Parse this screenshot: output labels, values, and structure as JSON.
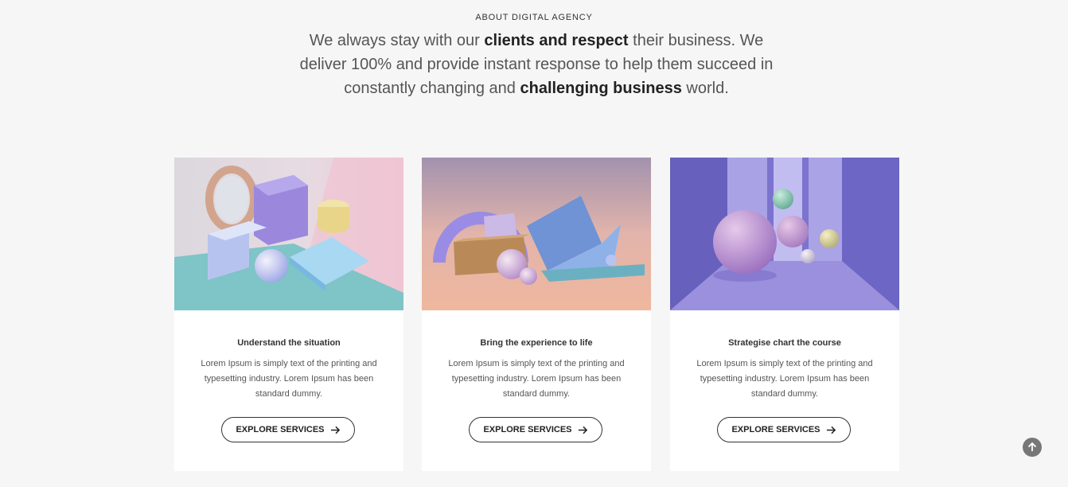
{
  "about": {
    "eyebrow": "ABOUT DIGITAL AGENCY",
    "intro_parts": [
      {
        "text": "We always stay with our ",
        "bold": false
      },
      {
        "text": "clients and respect",
        "bold": true
      },
      {
        "text": " their business. We deliver 100% and provide instant response to help them succeed in constantly changing and ",
        "bold": false
      },
      {
        "text": "challenging business",
        "bold": true
      },
      {
        "text": " world.",
        "bold": false
      }
    ]
  },
  "cards": [
    {
      "title": "Understand the situation",
      "description": "Lorem Ipsum is simply text of the printing and typesetting industry. Lorem Ipsum has been standard dummy.",
      "button_label": "EXPLORE SERVICES",
      "image_icon": "geometric-shapes-illustration"
    },
    {
      "title": "Bring the experience to life",
      "description": "Lorem Ipsum is simply text of the printing and typesetting industry. Lorem Ipsum has been standard dummy.",
      "button_label": "EXPLORE SERVICES",
      "image_icon": "arch-and-blocks-illustration"
    },
    {
      "title": "Strategise chart the course",
      "description": "Lorem Ipsum is simply text of the printing and typesetting industry. Lorem Ipsum has been standard dummy.",
      "button_label": "EXPLORE SERVICES",
      "image_icon": "spheres-corridor-illustration"
    }
  ],
  "scroll_top": {
    "icon": "arrow-up-icon"
  },
  "colors": {
    "background": "#f6f6f6",
    "card": "#ffffff",
    "text": "#333333",
    "scroll_button": "#777777"
  }
}
